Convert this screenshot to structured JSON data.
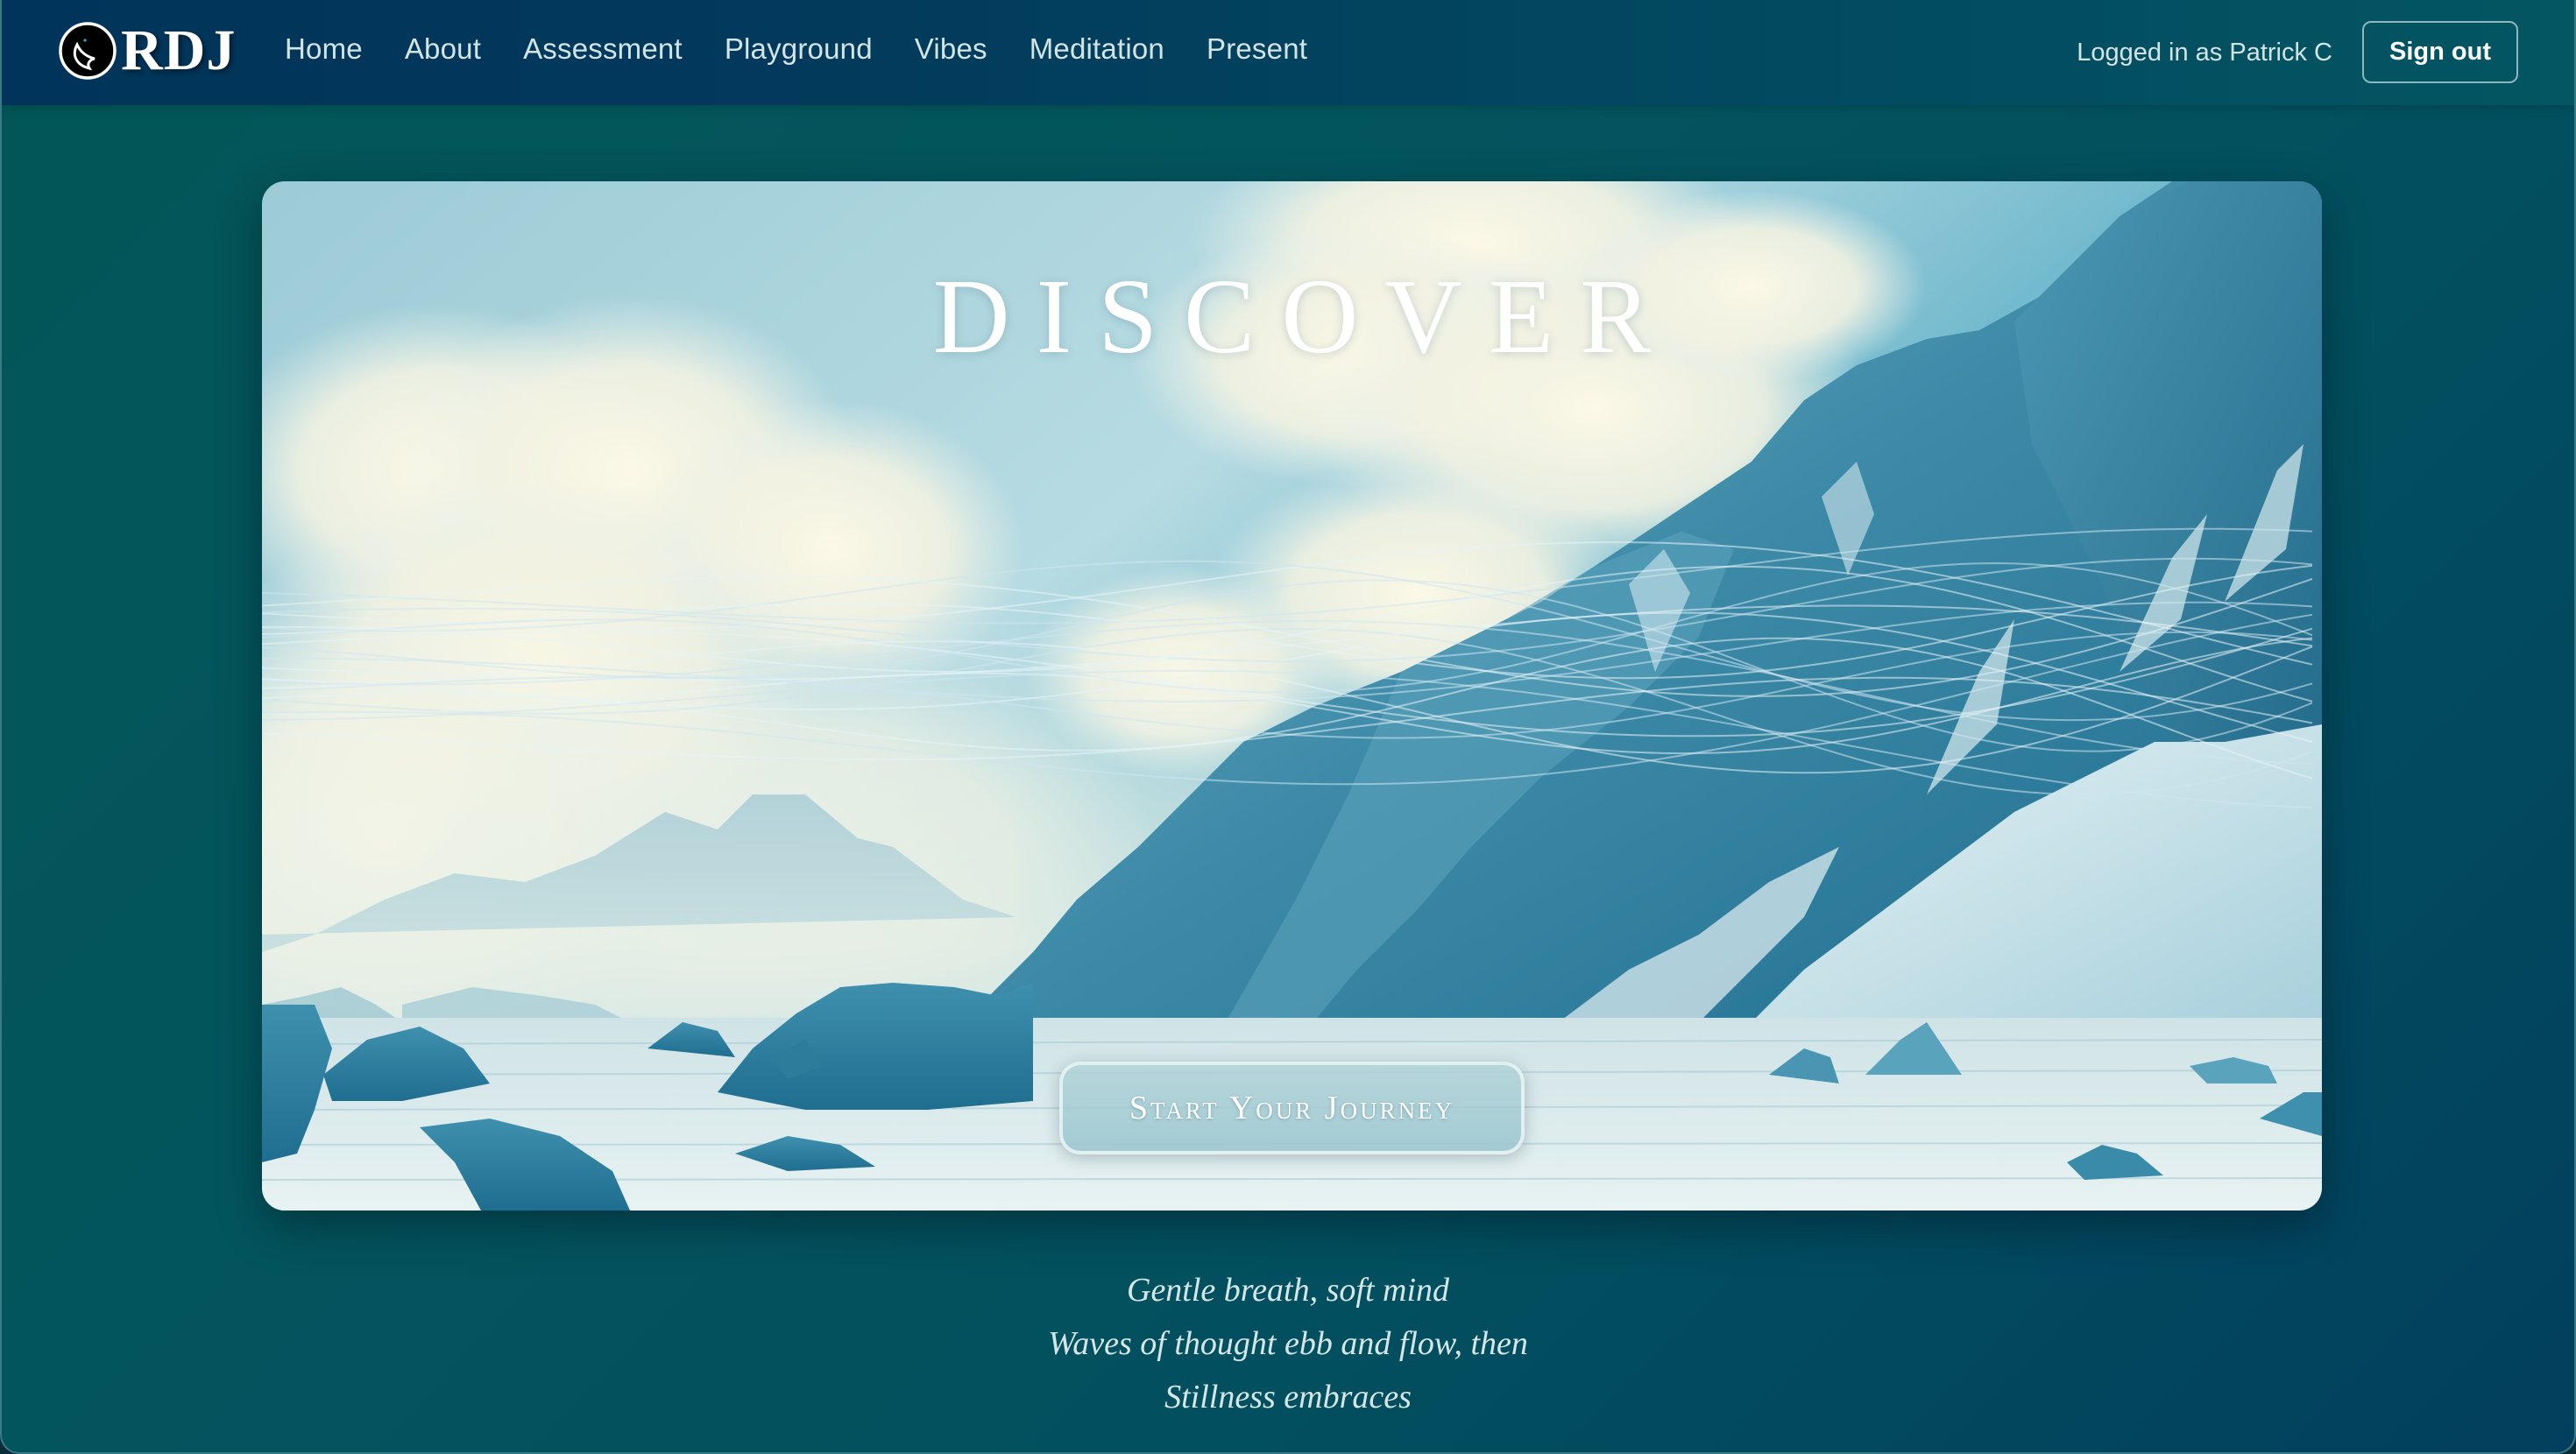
{
  "navbar": {
    "logo": {
      "text": "RDJ",
      "icon": "bird-circle-logo-icon"
    },
    "links": [
      {
        "label": "Home"
      },
      {
        "label": "About"
      },
      {
        "label": "Assessment"
      },
      {
        "label": "Playground"
      },
      {
        "label": "Vibes"
      },
      {
        "label": "Meditation"
      },
      {
        "label": "Present"
      }
    ],
    "user_status": "Logged in as Patrick C",
    "sign_out_label": "Sign out"
  },
  "hero": {
    "title": "DISCOVER",
    "cta_label": "Start Your Journey",
    "scene": "arctic-mountains-clouds-ice-floes"
  },
  "poem": {
    "lines": [
      "Gentle breath, soft mind",
      "Waves of thought ebb and flow, then",
      "Stillness embraces"
    ]
  },
  "colors": {
    "navbar_start": "#01345a",
    "navbar_end": "#035662",
    "page_bg_start": "#035657",
    "page_bg_end": "#023f5e",
    "nav_text": "#d3e4e4",
    "poem_text": "#d6e6e6"
  }
}
